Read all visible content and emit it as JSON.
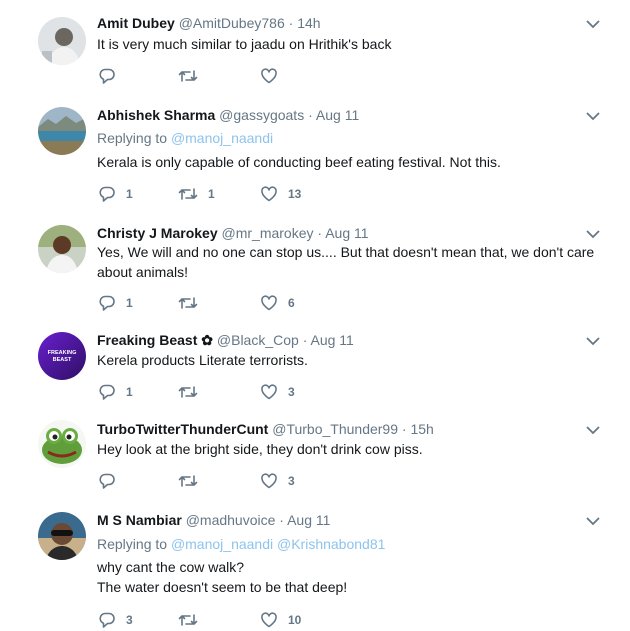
{
  "colors": {
    "accent": "#1da1f2",
    "mention": "#8dc4ed",
    "muted": "#657786",
    "thread_line": "#cfe6f7"
  },
  "tweets": [
    {
      "name": "Amit Dubey",
      "handle": "@AmitDubey786",
      "sep": "·",
      "time": "14h",
      "replying_label": "",
      "mentions": [],
      "lines": [
        "It is very much similar to jaadu on Hrithik's back"
      ],
      "replies": "",
      "retweets": "",
      "likes": ""
    },
    {
      "name": "Abhishek Sharma",
      "handle": "@gassygoats",
      "sep": "·",
      "time": "Aug 11",
      "replying_label": "Replying to",
      "mentions": [
        "@manoj_naandi"
      ],
      "lines": [
        "Kerala is only capable of conducting beef eating festival. Not this."
      ],
      "replies": "1",
      "retweets": "1",
      "likes": "13"
    },
    {
      "name": "Christy J Marokey",
      "handle": "@mr_marokey",
      "sep": "·",
      "time": "Aug 11",
      "replying_label": "",
      "mentions": [],
      "lines": [
        "Yes, We will and no one can stop us.... But that doesn't mean that, we don't care",
        "about animals!"
      ],
      "replies": "1",
      "retweets": "",
      "likes": "6"
    },
    {
      "name": "Freaking Beast ✿",
      "handle": "@Black_Cop",
      "sep": "·",
      "time": "Aug 11",
      "replying_label": "",
      "mentions": [],
      "lines": [
        "Kerela products Literate terrorists."
      ],
      "replies": "1",
      "retweets": "",
      "likes": "3",
      "avatar_text": [
        "FREAKING",
        "BEAST"
      ]
    },
    {
      "name": "TurboTwitterThunderCunt",
      "handle": "@Turbo_Thunder99",
      "sep": "·",
      "time": "15h",
      "replying_label": "",
      "mentions": [],
      "lines": [
        "Hey look at the bright side, they don't drink cow piss."
      ],
      "replies": "",
      "retweets": "",
      "likes": "3"
    },
    {
      "name": "M S Nambiar",
      "handle": "@madhuvoice",
      "sep": "·",
      "time": "Aug 11",
      "replying_label": "Replying to",
      "mentions": [
        "@manoj_naandi",
        "@Krishnabond81"
      ],
      "lines": [
        "why cant the cow walk?",
        "The water doesn't seem to be that deep!"
      ],
      "replies": "3",
      "retweets": "",
      "likes": "10"
    }
  ]
}
